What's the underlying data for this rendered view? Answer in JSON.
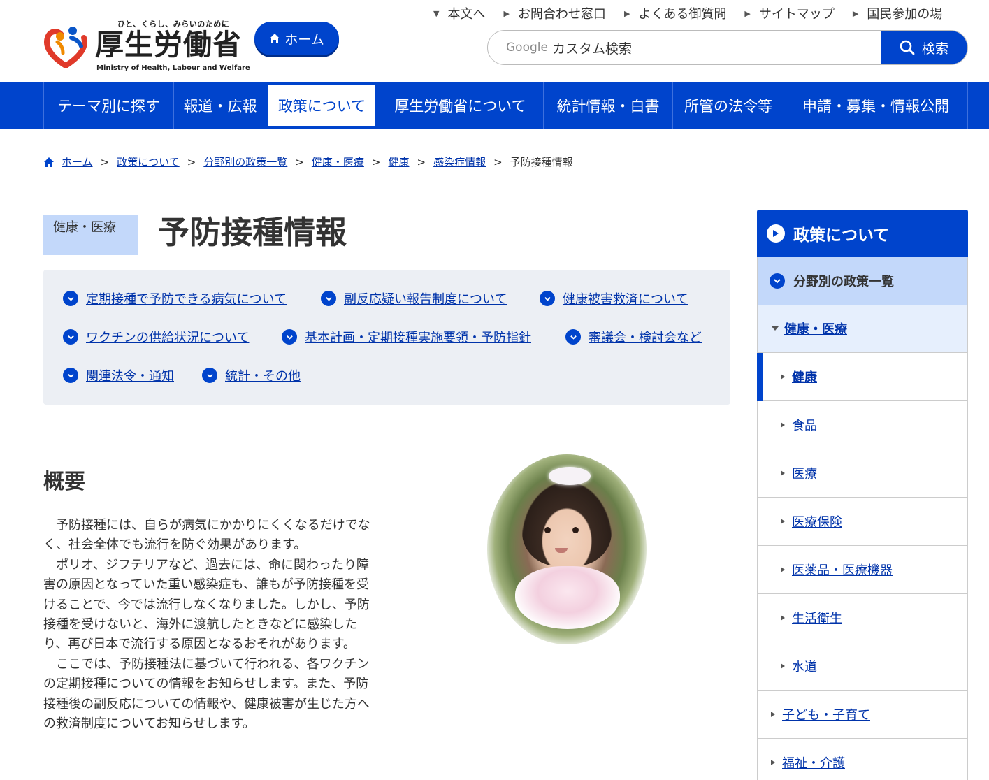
{
  "header": {
    "tagline": "ひと、くらし、みらいのために",
    "logo_jp": "厚生労働省",
    "logo_en": "Ministry of Health, Labour and Welfare",
    "home_label": "ホーム",
    "top_links": [
      "本文へ",
      "お問合わせ窓口",
      "よくある御質問",
      "サイトマップ",
      "国民参加の場"
    ],
    "search": {
      "brand": "Google",
      "placeholder": "カスタム検索",
      "button_label": "検索"
    }
  },
  "global_nav": [
    "テーマ別に探す",
    "報道・広報",
    "政策について",
    "厚生労働省について",
    "統計情報・白書",
    "所管の法令等",
    "申請・募集・情報公開"
  ],
  "global_nav_active": "政策について",
  "breadcrumb": {
    "links": [
      "ホーム",
      "政策について",
      "分野別の政策一覧",
      "健康・医療",
      "健康",
      "感染症情報"
    ],
    "current": "予防接種情報"
  },
  "page": {
    "category": "健康・医療",
    "title": "予防接種情報"
  },
  "anchor_links": [
    "定期接種で予防できる病気について",
    "副反応疑い報告制度について",
    "健康被害救済について",
    "ワクチンの供給状況について",
    "基本計画・定期接種実施要領・予防指針",
    "審議会・検討会など",
    "関連法令・通知",
    "統計・その他"
  ],
  "overview": {
    "heading": "概要",
    "paragraphs": [
      "予防接種には、自らが病気にかかりにくくなるだけでなく、社会全体でも流行を防ぐ効果があります。",
      "ポリオ、ジフテリアなど、過去には、命に関わったり障害の原因となっていた重い感染症も、誰もが予防接種を受けることで、今では流行しなくなりました。しかし、予防接種を受けないと、海外に渡航したときなどに感染したり、再び日本で流行する原因となるおそれがあります。",
      "ここでは、予防接種法に基づいて行われる、各ワクチンの定期接種についての情報をお知らせします。また、予防接種後の副反応についての情報や、健康被害が生じた方への救済制度についてお知らせします。"
    ]
  },
  "side_nav": {
    "heading": "政策について",
    "level1": "分野別の政策一覧",
    "level2": "健康・医療",
    "sub_items": [
      "健康",
      "食品",
      "医療",
      "医療保険",
      "医薬品・医療機器",
      "生活衛生",
      "水道"
    ],
    "selected": "健康",
    "top_items": [
      "子ども・子育て",
      "福祉・介護"
    ]
  },
  "colors": {
    "brand_blue": "#0044cc",
    "light_blue": "#c3d8fa",
    "link": "#0033aa",
    "box_bg": "#eceff4"
  }
}
